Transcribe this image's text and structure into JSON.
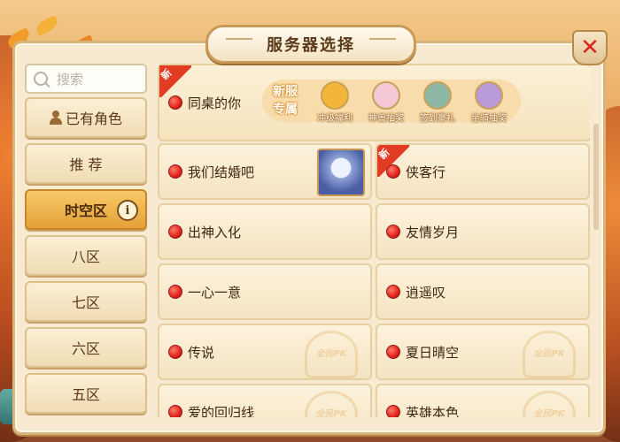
{
  "header": {
    "title": "服务器选择",
    "close_symbol": "✕"
  },
  "sidebar": {
    "search_placeholder": "搜索",
    "items": [
      {
        "label": "已有角色"
      },
      {
        "label": "推 荐"
      },
      {
        "label": "时空区",
        "info_symbol": "i"
      },
      {
        "label": "八区"
      },
      {
        "label": "七区"
      },
      {
        "label": "六区"
      },
      {
        "label": "五区"
      }
    ],
    "active_item": "时空区"
  },
  "featured_server": {
    "name": "同桌的你",
    "new_tag": "新",
    "promo_badge_line1": "新服",
    "promo_badge_line2": "专属",
    "rewards": [
      {
        "label": "冲级福利",
        "icon": "gold-coin-icon",
        "color": "#f3b63a"
      },
      {
        "label": "神兽抽奖",
        "icon": "pet-egg-icon",
        "color": "#f4c8d6"
      },
      {
        "label": "签到豪礼",
        "icon": "gift-box-icon",
        "color": "#8fb7a8"
      },
      {
        "label": "坐骑抽奖",
        "icon": "mount-icon",
        "color": "#b89ad8"
      }
    ]
  },
  "servers": [
    {
      "name": "我们结婚吧",
      "has_avatar": true
    },
    {
      "name": "侠客行",
      "new_tag": "新"
    },
    {
      "name": "出神入化"
    },
    {
      "name": "友情岁月"
    },
    {
      "name": "一心一意"
    },
    {
      "name": "逍遥叹"
    },
    {
      "name": "传说",
      "watermark": "全民PK"
    },
    {
      "name": "夏日晴空",
      "watermark": "全民PK"
    },
    {
      "name": "爱的回归线",
      "watermark": "全民PK"
    },
    {
      "name": "英雄本色",
      "watermark": "全民PK"
    }
  ],
  "colors": {
    "status_dot": "#e0221a",
    "active_tab": "#e4a138",
    "new_tag": "#e23c24"
  }
}
